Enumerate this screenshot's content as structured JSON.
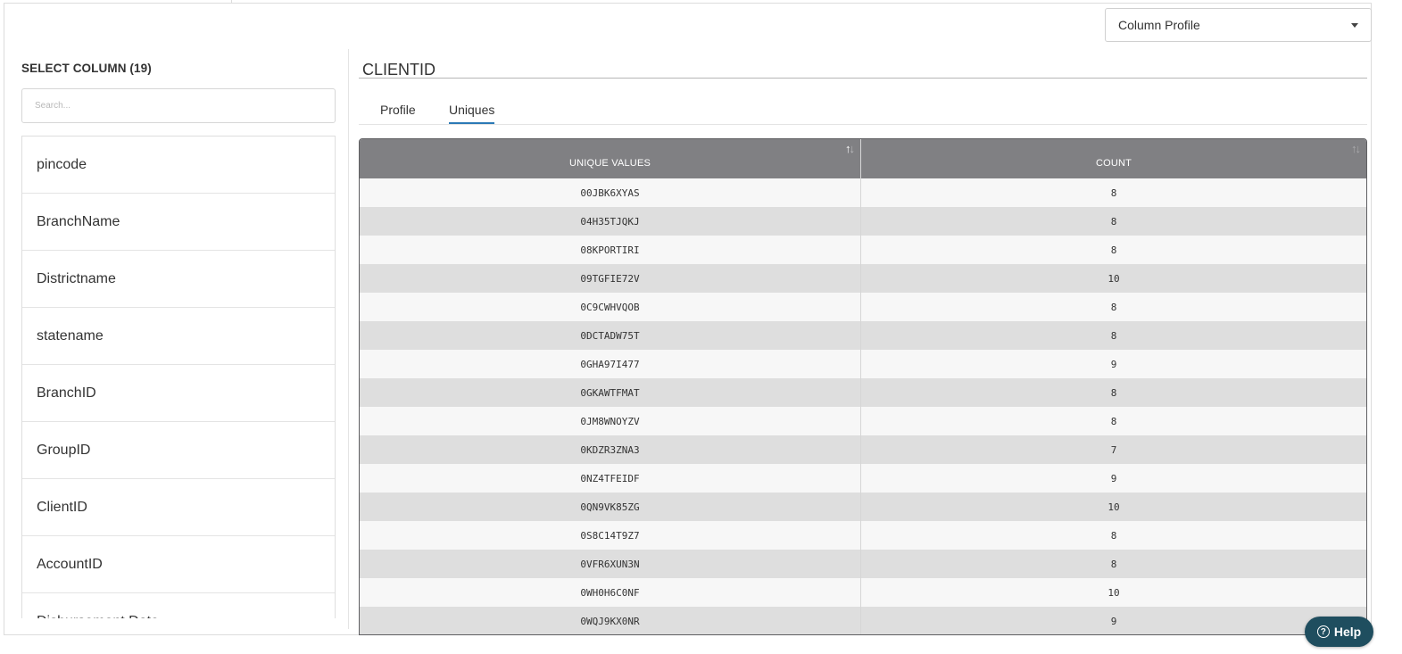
{
  "view_selector": {
    "selected": "Column Profile"
  },
  "left_panel": {
    "heading": "SELECT COLUMN (19)",
    "search_placeholder": "Search...",
    "columns": [
      "pincode",
      "BranchName",
      "Districtname",
      "statename",
      "BranchID",
      "GroupID",
      "ClientID",
      "AccountID",
      "Disbursement Date"
    ]
  },
  "main": {
    "column_title": "CLIENTID",
    "tabs": [
      {
        "label": "Profile",
        "active": false
      },
      {
        "label": "Uniques",
        "active": true
      }
    ],
    "table": {
      "headers": [
        "UNIQUE VALUES",
        "COUNT"
      ],
      "rows": [
        [
          "00JBK6XYAS",
          "8"
        ],
        [
          "04H35TJQKJ",
          "8"
        ],
        [
          "08KPORTIRI",
          "8"
        ],
        [
          "09TGFIE72V",
          "10"
        ],
        [
          "0C9CWHVQOB",
          "8"
        ],
        [
          "0DCTADW75T",
          "8"
        ],
        [
          "0GHA97I477",
          "9"
        ],
        [
          "0GKAWTFMAT",
          "8"
        ],
        [
          "0JM8WNOYZV",
          "8"
        ],
        [
          "0KDZR3ZNA3",
          "7"
        ],
        [
          "0NZ4TFEIDF",
          "9"
        ],
        [
          "0QN9VK85ZG",
          "10"
        ],
        [
          "0S8C14T9Z7",
          "8"
        ],
        [
          "0VFR6XUN3N",
          "8"
        ],
        [
          "0WH0H6C0NF",
          "10"
        ],
        [
          "0WQJ9KX0NR",
          "9"
        ]
      ]
    }
  },
  "help": {
    "label": "Help",
    "icon_glyph": "?"
  },
  "icons": {
    "sort_up": "↑",
    "sort_down": "↓"
  },
  "colors": {
    "header_bg": "#808083",
    "tab_active": "#2b79b6",
    "help_bg": "#1f4e5f"
  }
}
